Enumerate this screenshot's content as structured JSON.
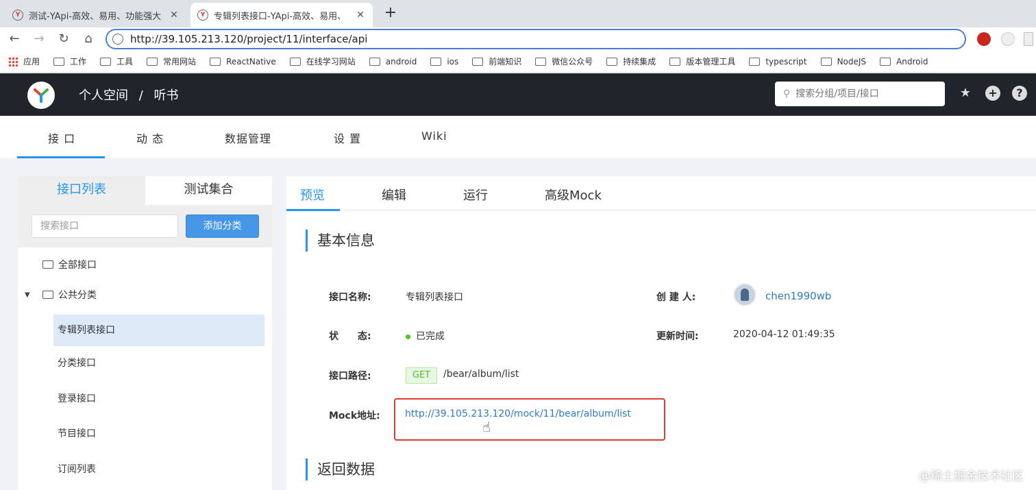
{
  "browser": {
    "tabs": [
      {
        "title": "测试-YApi-高效、易用、功能强大",
        "active": false
      },
      {
        "title": "专辑列表接口-YApi-高效、易用、",
        "active": true
      }
    ],
    "new_tab_icon": "plus-icon",
    "url": "http://39.105.213.120/project/11/interface/api",
    "bookmarks": [
      "应用",
      "工作",
      "工具",
      "常用网站",
      "ReactNative",
      "在线学习网站",
      "android",
      "ios",
      "前端知识",
      "微信公众号",
      "持续集成",
      "版本管理工具",
      "typescript",
      "NodeJS",
      "Android"
    ]
  },
  "header": {
    "breadcrumb": [
      "个人空间",
      "/",
      "听书"
    ],
    "search_placeholder": "搜索分组/项目/接口"
  },
  "subnav": {
    "items": [
      "接 口",
      "动 态",
      "数据管理",
      "设 置",
      "Wiki"
    ],
    "active_index": 0
  },
  "sidebar": {
    "tabs": [
      "接口列表",
      "测试集合"
    ],
    "search_placeholder": "搜索接口",
    "add_button": "添加分类",
    "all_label": "全部接口",
    "category_label": "公共分类",
    "items": [
      "专辑列表接口",
      "分类接口",
      "登录接口",
      "节目接口",
      "订阅列表"
    ],
    "selected_index": 0
  },
  "content": {
    "tabs": [
      "预览",
      "编辑",
      "运行",
      "高级Mock"
    ],
    "active_tab": 0,
    "section_basic": "基本信息",
    "section_return": "返回数据",
    "fields": {
      "name_label": "接口名称:",
      "name_value": "专辑列表接口",
      "creator_label": "创 建 人:",
      "creator_value": "chen1990wb",
      "status_label": "状　　态:",
      "status_value": "已完成",
      "updated_label": "更新时间:",
      "updated_value": "2020-04-12 01:49:35",
      "path_label": "接口路径:",
      "method": "GET",
      "path_value": "/bear/album/list",
      "mock_label": "Mock地址:",
      "mock_value": "http://39.105.213.120/mock/11/bear/album/list"
    }
  },
  "watermark": "@稀土掘金技术社区",
  "colors": {
    "accent": "#2395f1",
    "header_bg": "#20252b",
    "highlight_box": "#e03b2e",
    "status_green": "#52c41a"
  }
}
